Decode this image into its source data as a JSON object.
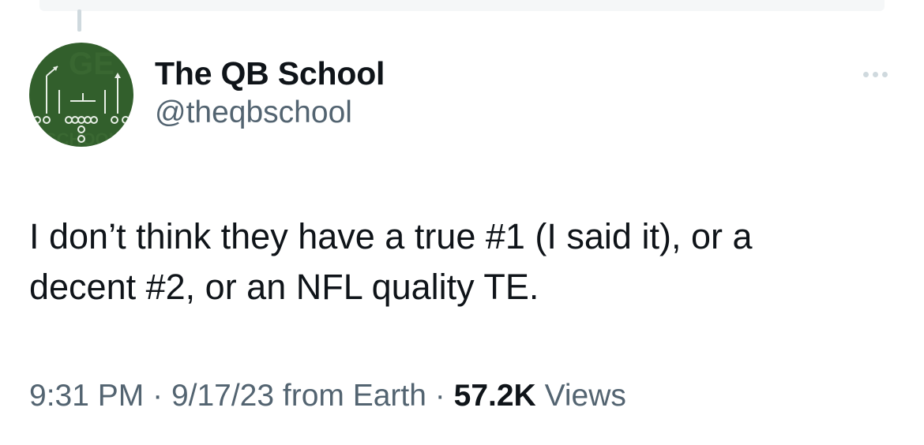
{
  "author": {
    "display_name": "The QB School",
    "handle": "@theqbschool",
    "avatar_icon": "football-playbook-icon",
    "avatar_color": "#2f5a2a"
  },
  "tweet": {
    "text": "I don’t think they have a true #1 (I said it), or a\ndecent #2, or an NFL quality TE."
  },
  "meta": {
    "time": "9:31 PM",
    "separator": "·",
    "date_source": "9/17/23 from Earth",
    "views_count": "57.2K",
    "views_label": "Views"
  },
  "more_icon": "more-dots-icon"
}
